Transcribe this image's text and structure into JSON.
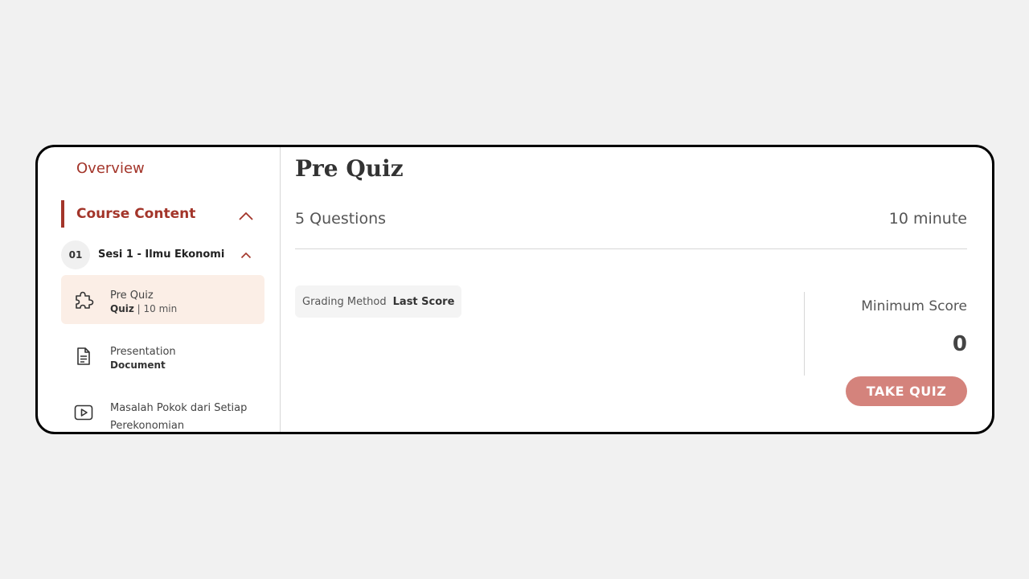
{
  "sidebar": {
    "overview_label": "Overview",
    "course_content_label": "Course Content",
    "session": {
      "number": "01",
      "title": "Sesi 1 - Ilmu Ekonomi"
    },
    "items": [
      {
        "icon": "puzzle-icon",
        "name": "Pre Quiz",
        "type": "Quiz",
        "meta": " | 10 min"
      },
      {
        "icon": "document-icon",
        "name": "Presentation",
        "type": "Document",
        "meta": ""
      },
      {
        "icon": "play-video-icon",
        "name": "Masalah Pokok dari Setiap Perekonomian",
        "type": "",
        "meta": ""
      }
    ]
  },
  "main": {
    "title": "Pre Quiz",
    "questions": "5 Questions",
    "duration": "10 minute",
    "grading_label": "Grading Method",
    "grading_value": "Last Score",
    "min_score_label": "Minimum Score",
    "min_score_value": "0",
    "take_quiz_label": "TAKE QUIZ"
  },
  "colors": {
    "accent": "#a3352a",
    "active_item_bg": "#fbeee6",
    "button_bg": "#d4837c"
  }
}
